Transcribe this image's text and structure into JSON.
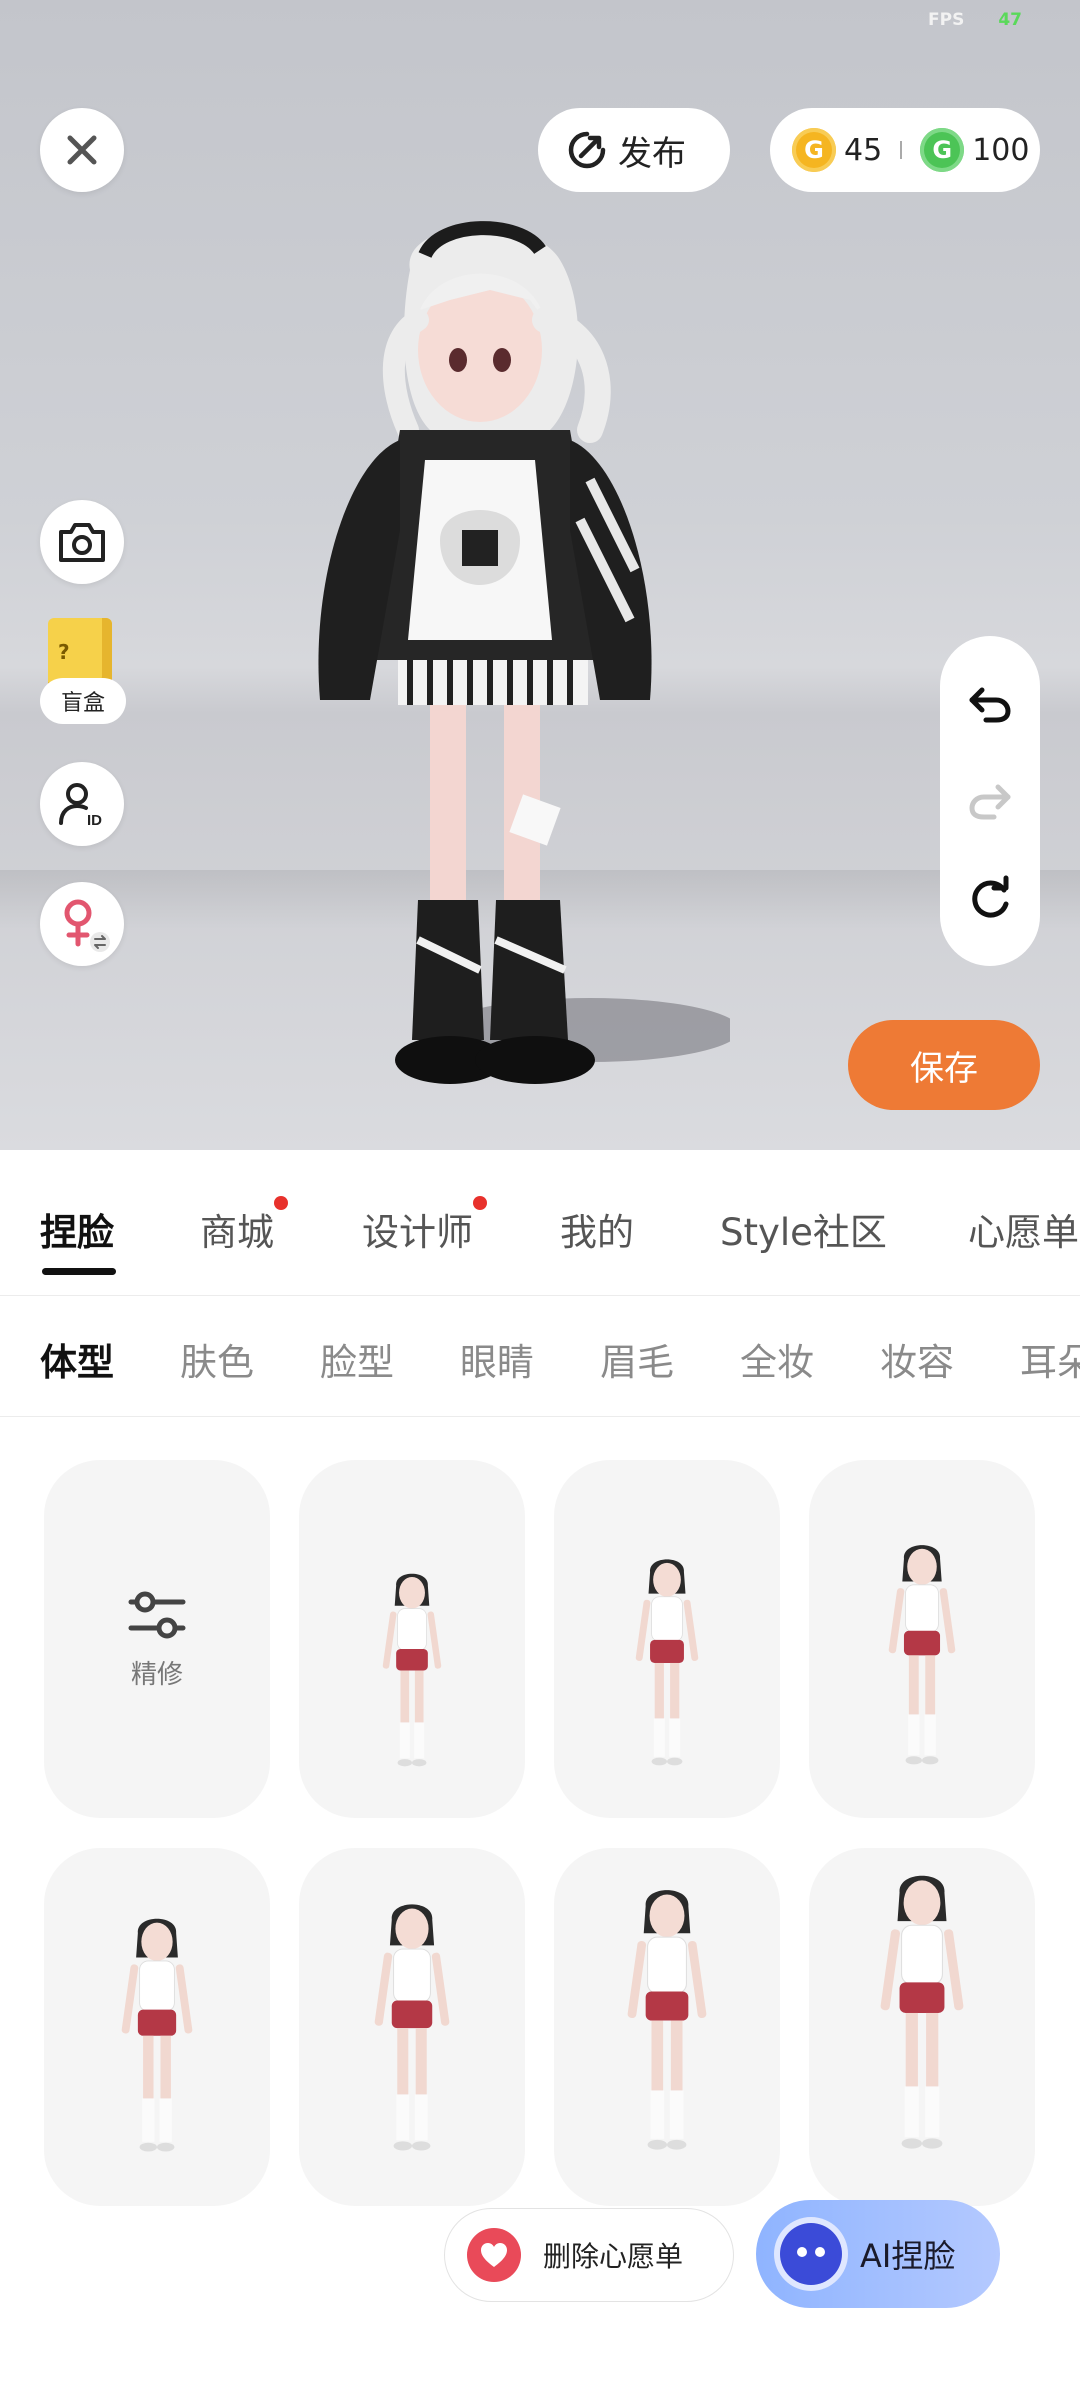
{
  "status": {
    "fps_label": "FPS",
    "fps_value": "47"
  },
  "top": {
    "publish_label": "发布",
    "coins": [
      {
        "icon": "gold-coin-icon",
        "value": "45"
      },
      {
        "icon": "green-coin-icon",
        "value": "100"
      }
    ]
  },
  "left_tools": {
    "blind_box_label": "盲盒"
  },
  "save_label": "保存",
  "main_tabs": [
    "捏脸",
    "商城",
    "设计师",
    "我的",
    "Style社区",
    "心愿单"
  ],
  "sub_tabs": [
    "体型",
    "肤色",
    "脸型",
    "眼睛",
    "眉毛",
    "全妆",
    "妆容",
    "耳朵"
  ],
  "grid": {
    "adjust_label": "精修"
  },
  "bottom": {
    "wishlist_label": "删除心愿单",
    "ai_label": "AI捏脸"
  },
  "colors": {
    "accent": "#ee7a35",
    "badge": "#e8312c"
  }
}
